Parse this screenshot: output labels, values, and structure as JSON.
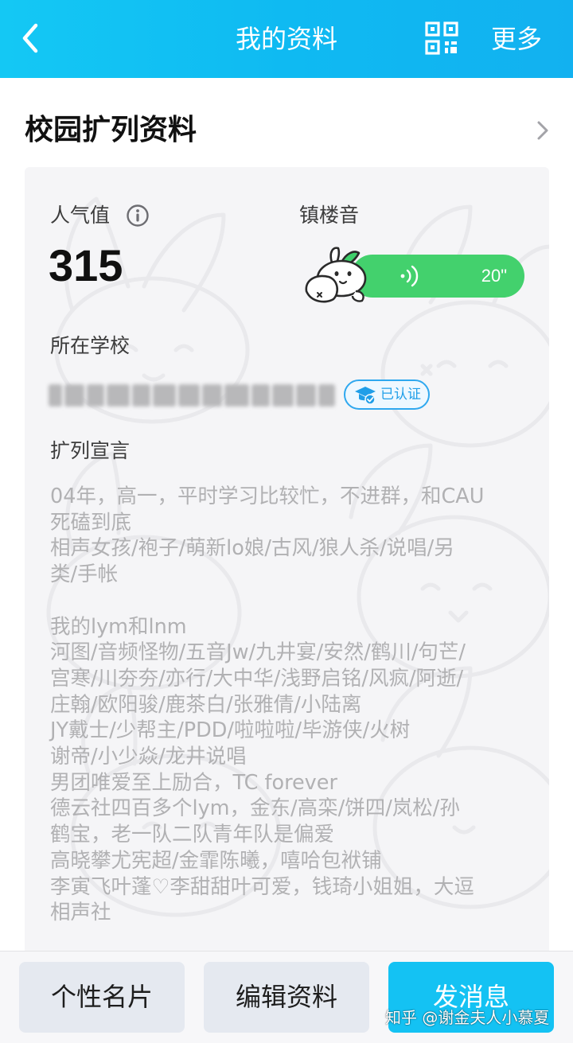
{
  "header": {
    "back_icon": "chevron-left-icon",
    "title": "我的资料",
    "qr_icon": "qr-code-icon",
    "more_label": "更多",
    "bg_color": "#12bdf3"
  },
  "section": {
    "title": "校园扩列资料",
    "chevron_icon": "chevron-right-icon"
  },
  "card": {
    "popularity_label": "人气值",
    "popularity_value": "315",
    "voice_label": "镇楼音",
    "voice_duration": "20\"",
    "voice_color": "#43d16d",
    "school_label": "所在学校",
    "verified_text": "已认证",
    "declaration_label": "扩列宣言",
    "declaration_text": "04年，高一，平时学习比较忙，不进群，和CAU\n死磕到底\n相声女孩/袍子/萌新lo娘/古风/狼人杀/说唱/另\n类/手帐\n\n我的lym和lnm\n河图/音频怪物/五音Jw/九井宴/安然/鹤川/句芒/\n宫寒/川夯夯/亦行/大中华/浅野启铭/风疯/阿逝/\n庄翰/欧阳骏/鹿茶白/张雅倩/小陆离\nJY戴士/少帮主/PDD/啦啦啦/毕游侠/火树\n谢帝/小少焱/龙井说唱\n男团唯爱至上励合，TC forever\n德云社四百多个lym，金东/高栾/饼四/岚松/孙\n鹤宝，老一队二队青年队是偏爱\n高晓攀尤宪超/金霏陈曦，嘻哈包袱铺\n李寅飞叶蓬♡李甜甜叶可爱，钱琦小姐姐，大逗\n相声社"
  },
  "bottom": {
    "card_button": "个性名片",
    "edit_button": "编辑资料",
    "message_button": "发消息",
    "accent_color": "#14c2f3"
  },
  "watermark": "知乎 @谢金夫人小慕夏"
}
